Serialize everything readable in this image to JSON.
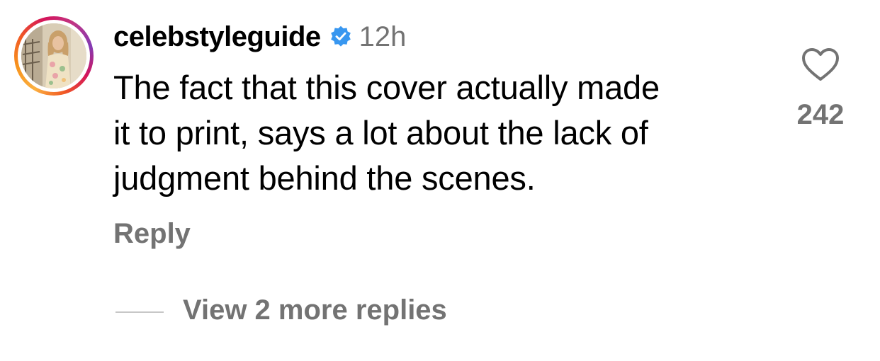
{
  "comment": {
    "username": "celebstyleguide",
    "verified_icon": "verified-badge-icon",
    "timestamp": "12h",
    "lines": [
      "The fact that this cover actually made",
      "it to print, says a lot about the lack of",
      "judgment behind the scenes."
    ],
    "reply_label": "Reply",
    "like_icon": "heart-outline-icon",
    "like_count": "242",
    "view_replies_label": "View 2 more replies"
  },
  "colors": {
    "text_primary": "#000000",
    "text_secondary": "#737373",
    "verified_blue": "#3897f0",
    "divider": "#c7c7c7"
  }
}
